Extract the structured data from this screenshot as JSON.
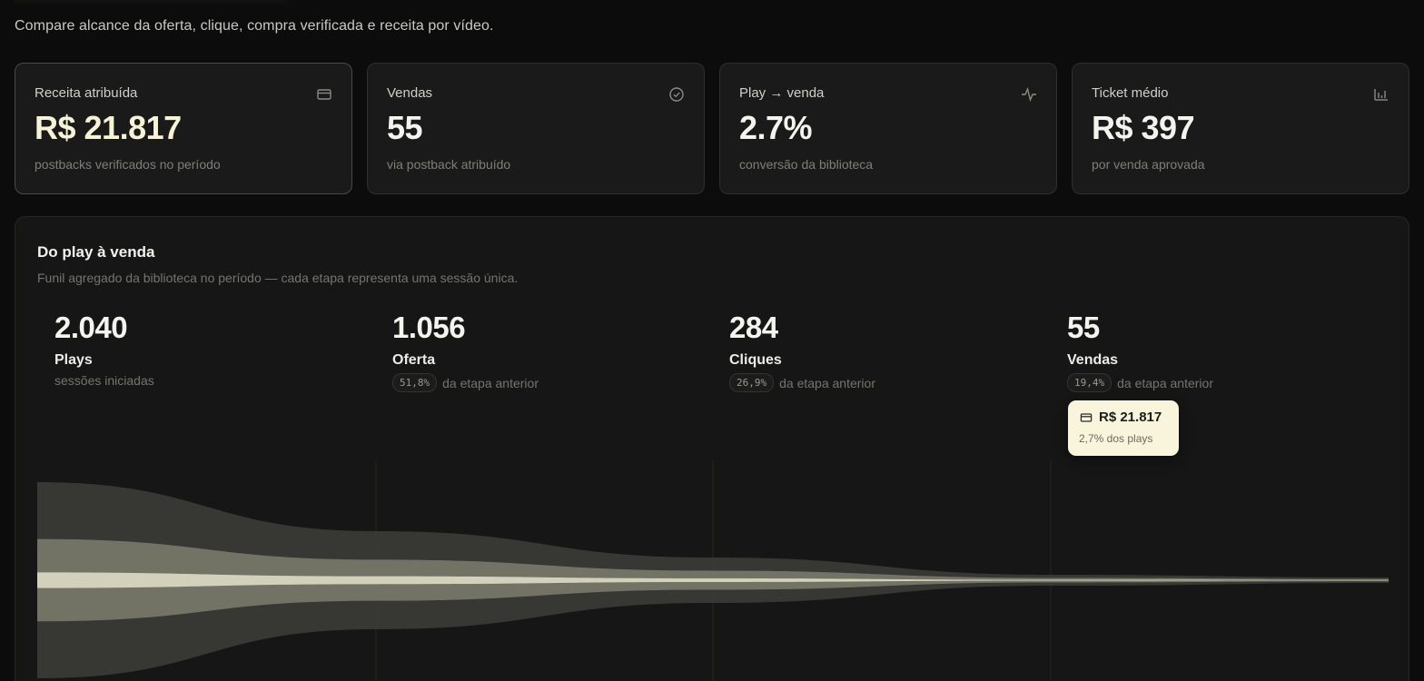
{
  "header": {
    "subtitle": "Compare alcance da oferta, clique, compra verificada e receita por vídeo."
  },
  "kpis": [
    {
      "label": "Receita atribuída",
      "value": "R$ 21.817",
      "note": "postbacks verificados no período",
      "icon": "credit-card-icon"
    },
    {
      "label": "Vendas",
      "value": "55",
      "note": "via postback atribuído",
      "icon": "check-circle-icon"
    },
    {
      "label": "Play → venda",
      "value": "2.7%",
      "note": "conversão da biblioteca",
      "icon": "activity-icon"
    },
    {
      "label": "Ticket médio",
      "value": "R$ 397",
      "note": "por venda aprovada",
      "icon": "bar-chart-icon"
    }
  ],
  "funnel": {
    "title": "Do play à venda",
    "description": "Funil agregado da biblioteca no período — cada etapa representa uma sessão única.",
    "previous_stage_suffix": "da etapa anterior",
    "stages": [
      {
        "value": "2.040",
        "name": "Plays",
        "note": "sessões iniciadas",
        "count": 2040
      },
      {
        "value": "1.056",
        "name": "Oferta",
        "pct": "51,8%",
        "count": 1056
      },
      {
        "value": "284",
        "name": "Cliques",
        "pct": "26,9%",
        "count": 284
      },
      {
        "value": "55",
        "name": "Vendas",
        "pct": "19,4%",
        "count": 55
      }
    ],
    "revenue_tooltip": {
      "value": "R$ 21.817",
      "sub": "2,7% dos plays",
      "icon": "credit-card-icon"
    },
    "colors": {
      "outer_band": "#3b3b37",
      "inner_band": "#7d7c6e",
      "core_line": "#f4f1d8"
    }
  }
}
